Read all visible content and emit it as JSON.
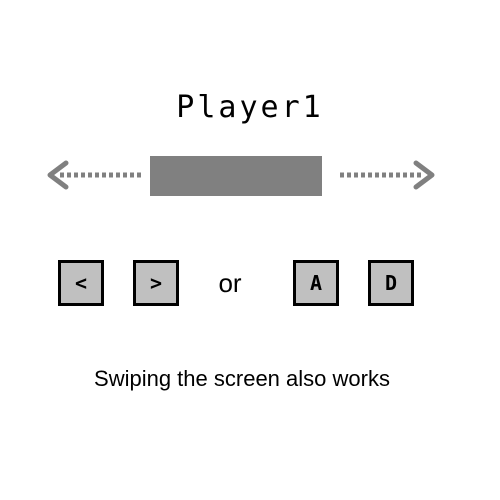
{
  "player": {
    "name": "Player1"
  },
  "controls": {
    "keys": {
      "left": "<",
      "right": ">",
      "a": "A",
      "d": "D"
    },
    "separator": "or"
  },
  "hint": "Swiping the screen also works",
  "colors": {
    "background": "#ffffff",
    "paddle": "#808080",
    "arrow": "#808080",
    "key_fill": "#c0c0c0",
    "key_border": "#000000",
    "text": "#000000"
  },
  "icons": {
    "left_arrow": "dotted-arrow-left-icon",
    "right_arrow": "dotted-arrow-right-icon"
  }
}
